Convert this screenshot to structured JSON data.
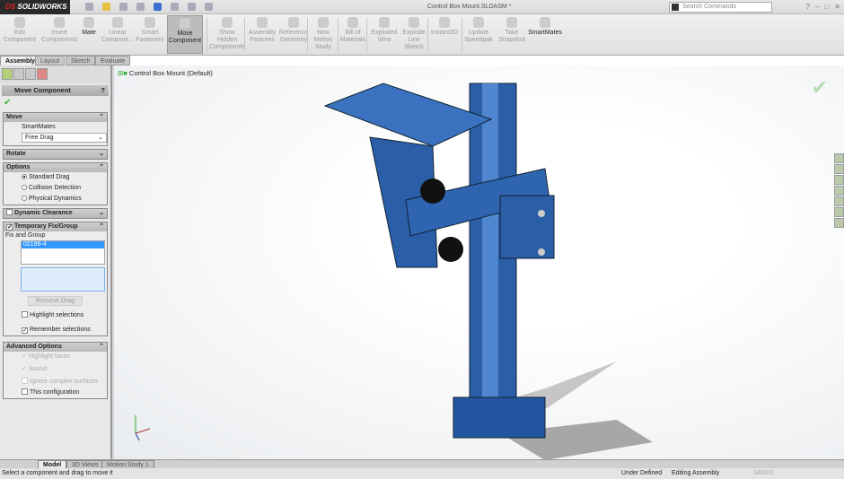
{
  "app": {
    "brand": "SOLIDWORKS",
    "title": "Control Box Mount.SLDASM *",
    "search_placeholder": "Search Commands"
  },
  "ribbon": [
    "Edit Component",
    "Insert Components",
    "Mate",
    "Linear Compone...",
    "Smart Fasteners",
    "Move Component",
    "Show Hidden Components",
    "Assembly Features",
    "Reference Geometry",
    "New Motion Study",
    "Bill of Materials",
    "Exploded View",
    "Explode Line Sketch",
    "Instant3D",
    "Update Speedpak",
    "Take Snapshot",
    "SmartMates"
  ],
  "tabs": [
    "Assembly",
    "Layout",
    "Sketch",
    "Evaluate"
  ],
  "tree_root": "Control Box Mount  (Default)",
  "pm": {
    "title": "Move Component",
    "help": "?",
    "move": {
      "header": "Move",
      "smartmates": "SmartMates",
      "drag": "Free Drag"
    },
    "rotate": {
      "header": "Rotate"
    },
    "options": {
      "header": "Options",
      "items": [
        {
          "label": "Standard Drag",
          "selected": true
        },
        {
          "label": "Collision Detection",
          "selected": false
        },
        {
          "label": "Physical Dynamics",
          "selected": false
        }
      ]
    },
    "dynamic": {
      "header": "Dynamic Clearance",
      "checked": false
    },
    "tempfix": {
      "header": "Temporary Fix/Group",
      "checked": true,
      "label": "Fix and Group",
      "item": "02196-4",
      "resume": "Resume Drag",
      "highlight": "Highlight selections",
      "highlight_checked": false,
      "remember": "Remember selections",
      "remember_checked": true
    },
    "advanced": {
      "header": "Advanced Options",
      "highlight_faces": "Highlight faces",
      "sound": "Sound",
      "ignore": "Ignore complex surfaces",
      "thisconfig": "This configuration"
    }
  },
  "bottom_tabs": [
    "Model",
    "3D Views",
    "Motion Study 1"
  ],
  "status": {
    "message": "Select a component and drag to move it",
    "state": "Under Defined",
    "mode": "Editing Assembly",
    "units": "MMGS"
  },
  "colors": {
    "part_blue": "#2a5fa8",
    "accent_check": "#3cae3c"
  }
}
